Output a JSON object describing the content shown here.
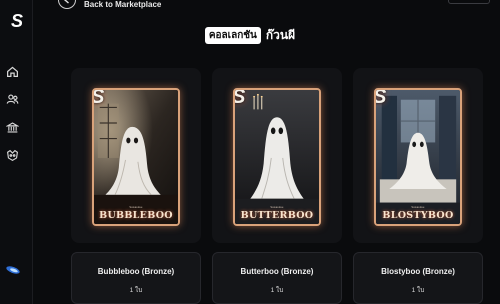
{
  "header": {
    "back_label": "Back to Marketplace"
  },
  "title": {
    "highlight": "คอลเลกชัน",
    "rest": "ก๊วนผี"
  },
  "sidebar": {
    "logo": "S",
    "items": [
      {
        "icon": "home-icon"
      },
      {
        "icon": "users-icon"
      },
      {
        "icon": "bank-icon"
      },
      {
        "icon": "mask-icon"
      }
    ]
  },
  "cards": [
    {
      "card_title": "BUBBLEBOO",
      "tag": "Sawasdee",
      "name": "Bubbleboo (Bronze)",
      "qty": "1 ใบ"
    },
    {
      "card_title": "BUTTERBOO",
      "tag": "Sawasdee",
      "name": "Butterboo (Bronze)",
      "qty": "1 ใบ"
    },
    {
      "card_title": "BLOSTYBOO",
      "tag": "Sawasdee",
      "name": "Blostyboo (Bronze)",
      "qty": "1 ใบ"
    }
  ],
  "colors": {
    "accent_border": "#d9a27a",
    "glow": "#ea8c5a",
    "background": "#0a0b0d"
  }
}
